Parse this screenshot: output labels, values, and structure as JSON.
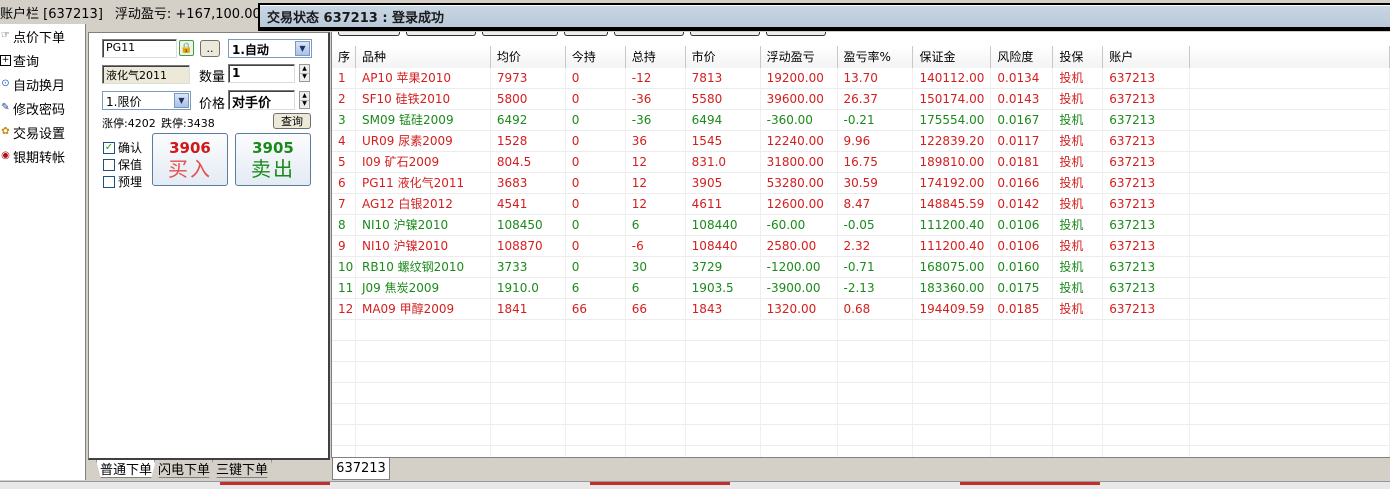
{
  "account_bar": {
    "label": "账户栏 [637213]",
    "float_pnl": "浮动盈亏: +167,100.00"
  },
  "status_bar": {
    "text": "交易状态 637213 : 登录成功"
  },
  "left_nav": {
    "items": [
      {
        "label": "点价下单",
        "icon": "hand-icon"
      },
      {
        "label": "查询",
        "icon": "plus-box-icon"
      },
      {
        "label": "自动换月",
        "icon": "cycle-icon"
      },
      {
        "label": "修改密码",
        "icon": "pencil-icon"
      },
      {
        "label": "交易设置",
        "icon": "gear-icon"
      },
      {
        "label": "银期转帐",
        "icon": "coin-icon"
      }
    ]
  },
  "order_form": {
    "contract_code": "PG11",
    "dots_label": "..",
    "open_close": "1.自动",
    "contract_name": "液化气2011",
    "qty_label": "数量",
    "quantity": "1",
    "order_type": "1.限价",
    "price_label": "价格",
    "price_value": "对手价",
    "limit_up": "涨停:4202",
    "limit_down": "跌停:3438",
    "query_label": "查询",
    "confirm_label": "确认",
    "hedge_label": "保值",
    "preset_label": "预埋",
    "confirm_checked": "✓",
    "buy_price": "3906",
    "buy_label": "买入",
    "sell_price": "3905",
    "sell_label": "卖出"
  },
  "left_tabs": [
    "普通下单",
    "闪电下单",
    "三键下单"
  ],
  "grid": {
    "columns": [
      "序",
      "品种",
      "均价",
      "今持",
      "总持",
      "市价",
      "浮动盈亏",
      "盈亏率%",
      "保证金",
      "风险度",
      "投保",
      "账户"
    ],
    "rows": [
      {
        "color": "red",
        "cells": [
          "1",
          "AP10 苹果2010",
          "7973",
          "0",
          "-12",
          "7813",
          "19200.00",
          "13.70",
          "140112.00",
          "0.0134",
          "投机",
          "637213"
        ]
      },
      {
        "color": "red",
        "cells": [
          "2",
          "SF10 硅铁2010",
          "5800",
          "0",
          "-36",
          "5580",
          "39600.00",
          "26.37",
          "150174.00",
          "0.0143",
          "投机",
          "637213"
        ]
      },
      {
        "color": "green",
        "cells": [
          "3",
          "SM09 锰硅2009",
          "6492",
          "0",
          "-36",
          "6494",
          "-360.00",
          "-0.21",
          "175554.00",
          "0.0167",
          "投机",
          "637213"
        ]
      },
      {
        "color": "red",
        "cells": [
          "4",
          "UR09 尿素2009",
          "1528",
          "0",
          "36",
          "1545",
          "12240.00",
          "9.96",
          "122839.20",
          "0.0117",
          "投机",
          "637213"
        ]
      },
      {
        "color": "red",
        "cells": [
          "5",
          "I09 矿石2009",
          "804.5",
          "0",
          "12",
          "831.0",
          "31800.00",
          "16.75",
          "189810.00",
          "0.0181",
          "投机",
          "637213"
        ]
      },
      {
        "color": "red",
        "cells": [
          "6",
          "PG11 液化气2011",
          "3683",
          "0",
          "12",
          "3905",
          "53280.00",
          "30.59",
          "174192.00",
          "0.0166",
          "投机",
          "637213"
        ]
      },
      {
        "color": "red",
        "cells": [
          "7",
          "AG12 白银2012",
          "4541",
          "0",
          "12",
          "4611",
          "12600.00",
          "8.47",
          "148845.59",
          "0.0142",
          "投机",
          "637213"
        ]
      },
      {
        "color": "green",
        "cells": [
          "8",
          "NI10 沪镍2010",
          "108450",
          "0",
          "6",
          "108440",
          "-60.00",
          "-0.05",
          "111200.40",
          "0.0106",
          "投机",
          "637213"
        ]
      },
      {
        "color": "red",
        "cells": [
          "9",
          "NI10 沪镍2010",
          "108870",
          "0",
          "-6",
          "108440",
          "2580.00",
          "2.32",
          "111200.40",
          "0.0106",
          "投机",
          "637213"
        ]
      },
      {
        "color": "green",
        "cells": [
          "10",
          "RB10 螺纹钢2010",
          "3733",
          "0",
          "30",
          "3729",
          "-1200.00",
          "-0.71",
          "168075.00",
          "0.0160",
          "投机",
          "637213"
        ]
      },
      {
        "color": "green",
        "cells": [
          "11",
          "J09 焦炭2009",
          "1910.0",
          "6",
          "6",
          "1903.5",
          "-3900.00",
          "-2.13",
          "183360.00",
          "0.0175",
          "投机",
          "637213"
        ]
      },
      {
        "color": "red",
        "cells": [
          "12",
          "MA09 甲醇2009",
          "1841",
          "66",
          "66",
          "1843",
          "1320.00",
          "0.68",
          "194409.59",
          "0.0185",
          "投机",
          "637213"
        ]
      }
    ],
    "empty_rows": 8
  },
  "grid_tab": "637213",
  "colors": {
    "loss_green": "#1a8a1a",
    "profit_red": "#d41e1e",
    "status_bar": "#c9d6e3"
  }
}
